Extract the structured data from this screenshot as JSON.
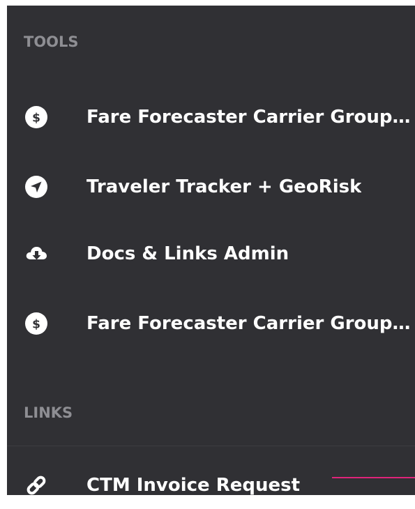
{
  "sections": {
    "tools": {
      "header": "TOOLS",
      "items": [
        {
          "label": "Fare Forecaster Carrier Group Report",
          "icon": "dollar-circle-icon"
        },
        {
          "label": "Traveler Tracker + GeoRisk",
          "icon": "location-arrow-icon"
        },
        {
          "label": "Docs & Links Admin",
          "icon": "cloud-download-icon"
        },
        {
          "label": "Fare Forecaster Carrier Group Report",
          "icon": "dollar-circle-icon"
        }
      ]
    },
    "links": {
      "header": "LINKS",
      "items": [
        {
          "label": "CTM Invoice Request",
          "icon": "link-icon"
        }
      ]
    }
  },
  "colors": {
    "background": "#303034",
    "header_text": "#8e8e93",
    "item_text": "#ffffff",
    "accent": "#e0247a"
  }
}
